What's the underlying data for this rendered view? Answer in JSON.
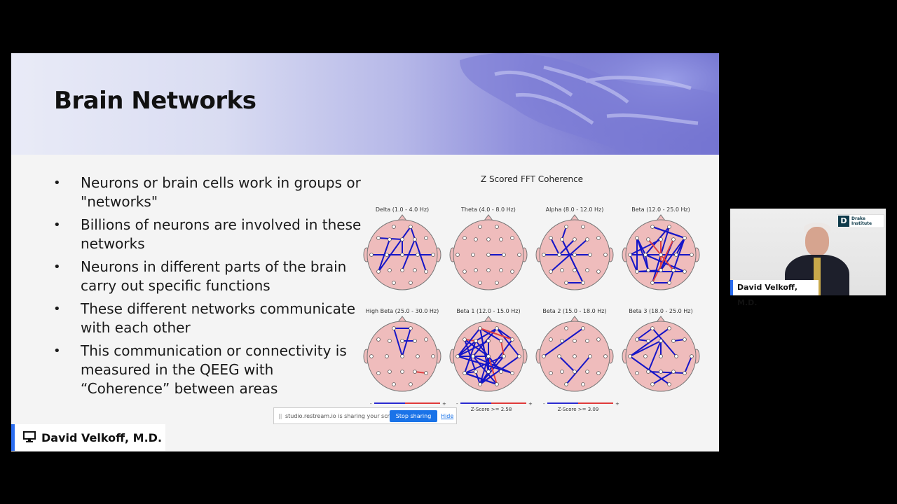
{
  "slide": {
    "title": "Brain Networks",
    "bullets": [
      "Neurons or brain cells work in groups or \"networks\"",
      "Billions of neurons are involved in these networks",
      "Neurons in different parts of the brain carry out specific functions",
      "These different networks communicate with each other",
      "This communication or connectivity is measured in the QEEG with “Coherence” between areas"
    ],
    "figure_title": "Z Scored FFT Coherence",
    "heads": [
      {
        "label": "Delta (1.0 - 4.0 Hz)",
        "lines": 9
      },
      {
        "label": "Theta (4.0 - 8.0 Hz)",
        "lines": 1
      },
      {
        "label": "Alpha (8.0 - 12.0 Hz)",
        "lines": 8
      },
      {
        "label": "Beta (12.0 - 25.0 Hz)",
        "lines": 26
      },
      {
        "label": "High Beta (25.0 - 30.0 Hz)",
        "lines": 5
      },
      {
        "label": "Beta 1 (12.0 - 15.0 Hz)",
        "lines": 34
      },
      {
        "label": "Beta 2 (15.0 - 18.0 Hz)",
        "lines": 3
      },
      {
        "label": "Beta 3 (18.0 - 25.0 Hz)",
        "lines": 12
      }
    ],
    "legends": [
      {
        "minus": "-",
        "plus": "+",
        "caption": ""
      },
      {
        "minus": "-",
        "plus": "+",
        "caption": "Z-Score >= 2.58"
      },
      {
        "minus": "-",
        "plus": "+",
        "caption": "Z-Score >= 3.09"
      }
    ],
    "colors": {
      "head_fill": "#efbcbc",
      "line_positive": "#1515c8",
      "line_negative": "#e04040"
    }
  },
  "share_bar": {
    "grip": "||",
    "message": "studio.restream.io is sharing your screen.",
    "stop_label": "Stop sharing",
    "hide_label": "Hide"
  },
  "presenter": {
    "name": "David Velkoff, M.D.",
    "icon": "monitor-icon"
  },
  "camera": {
    "name": "David Velkoff, M.D.",
    "logo_mark": "D",
    "logo_text": "Drake Institute"
  }
}
